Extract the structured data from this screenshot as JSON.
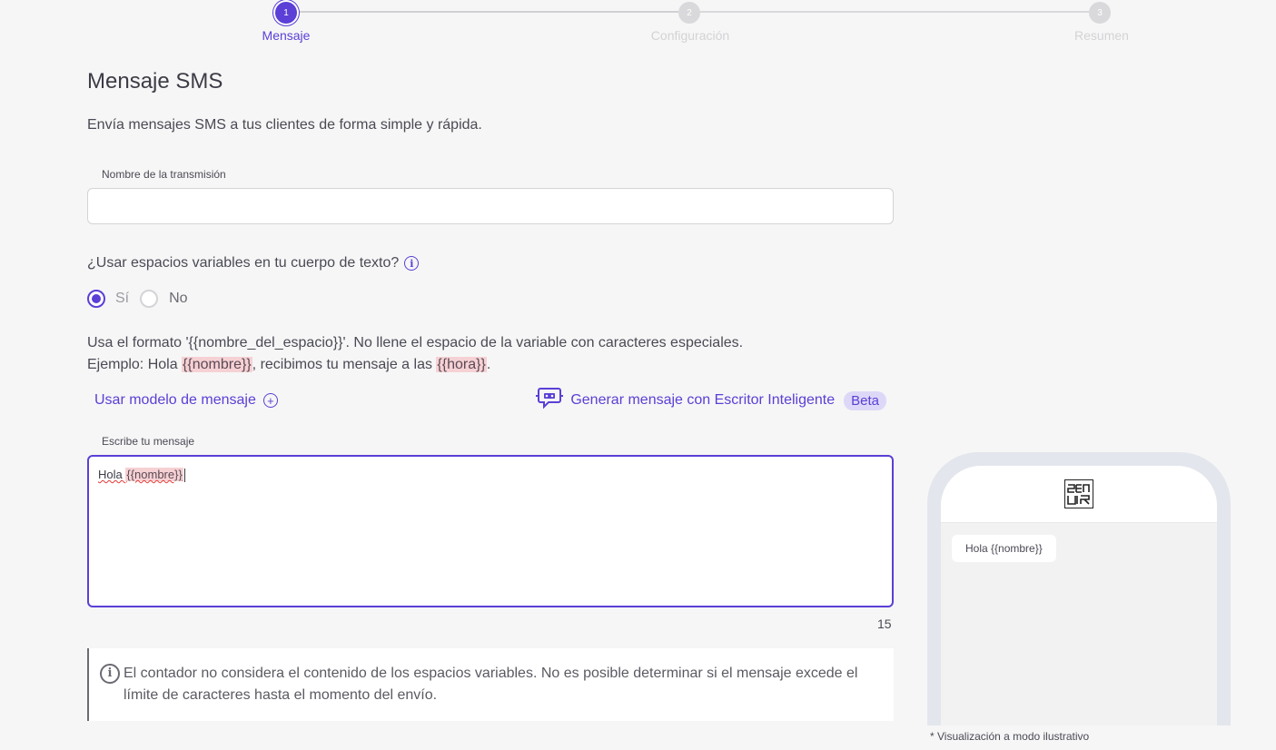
{
  "stepper": {
    "steps": [
      {
        "number": "1",
        "label": "Mensaje",
        "active": true
      },
      {
        "number": "2",
        "label": "Configuración",
        "active": false
      },
      {
        "number": "3",
        "label": "Resumen",
        "active": false
      }
    ]
  },
  "page": {
    "title": "Mensaje SMS",
    "subtitle": "Envía mensajes SMS a tus clientes de forma simple y rápida."
  },
  "broadcast_name": {
    "label": "Nombre de la transmisión",
    "value": ""
  },
  "variables": {
    "question": "¿Usar espacios variables en tu cuerpo de texto?",
    "options": [
      {
        "label": "Sí",
        "checked": true
      },
      {
        "label": "No",
        "checked": false
      }
    ],
    "help_line1": "Usa el formato '{{nombre_del_espacio}}'. No llene el espacio de la variable con caracteres especiales.",
    "example_prefix": "Ejemplo: Hola ",
    "example_var1": "{{nombre}}",
    "example_middle": ", recibimos tu mensaje a las ",
    "example_var2": "{{hora}}",
    "example_suffix": "."
  },
  "actions": {
    "use_template": "Usar modelo de mensaje",
    "smart_writer": "Generar mensaje con Escritor Inteligente",
    "beta_badge": "Beta"
  },
  "message": {
    "label": "Escribe tu mensaje",
    "text_prefix": "Hola ",
    "text_var": "{{nombre}}",
    "char_count": "15"
  },
  "notice": {
    "text": "El contador no considera el contenido de los espacios variables. No es posible determinar si el mensaje excede el límite de caracteres hasta el momento del envío."
  },
  "preview": {
    "bubble_text": "Hola {{nombre}}",
    "disclaimer": "* Visualización a modo ilustrativo"
  },
  "colors": {
    "accent": "#5b3fd6",
    "variable_highlight": "#f6d1d4",
    "background": "#f6f6f6"
  }
}
